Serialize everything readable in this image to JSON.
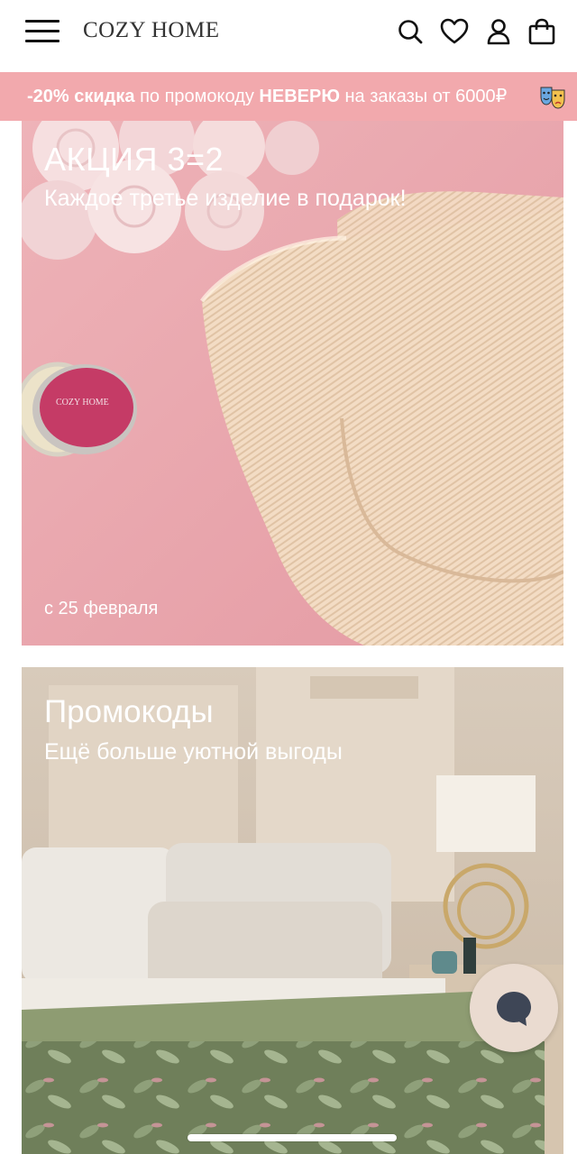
{
  "header": {
    "logo": "COZY HOME",
    "icons": [
      "menu-icon",
      "search-icon",
      "heart-icon",
      "user-icon",
      "bag-icon"
    ]
  },
  "promo": {
    "discount": "-20% скидка",
    "middle": " по промокоду ",
    "code": "НЕВЕРЮ",
    "tail": " на заказы от 6000₽ "
  },
  "banner1": {
    "title": "АКЦИЯ 3=2",
    "subtitle": "Каждое третье изделие в подарок!",
    "date": "с 25 февраля"
  },
  "banner2": {
    "title": "Промокоды",
    "subtitle": "Ещё больше уютной выгоды"
  },
  "colors": {
    "promo_bg": "#f2a9ad",
    "banner1_bg": "#e9a6ae",
    "chat_bg": "#eadbd0",
    "chat_icon": "#3e4656"
  }
}
